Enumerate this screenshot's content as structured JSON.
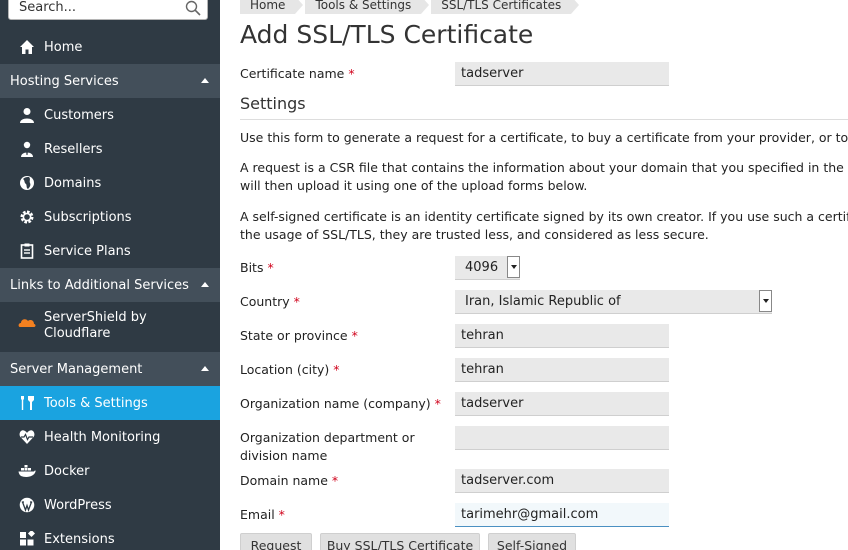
{
  "search": {
    "placeholder": "Search..."
  },
  "sidebar": {
    "home": "Home",
    "hosting_services": {
      "title": "Hosting Services",
      "items": [
        "Customers",
        "Resellers",
        "Domains",
        "Subscriptions",
        "Service Plans"
      ]
    },
    "additional_services": {
      "title": "Links to Additional Services",
      "items": [
        {
          "line1": "ServerShield by",
          "line2": "Cloudflare"
        }
      ]
    },
    "server_management": {
      "title": "Server Management",
      "items": [
        "Tools & Settings",
        "Health Monitoring",
        "Docker",
        "WordPress",
        "Extensions"
      ]
    }
  },
  "breadcrumb": [
    "Home",
    "Tools & Settings",
    "SSL/TLS Certificates"
  ],
  "page": {
    "title": "Add SSL/TLS Certificate",
    "settings_heading": "Settings",
    "para1": "Use this form to generate a request for a certificate, to buy a certificate from your provider, or to gen",
    "para2_line1": "A request is a CSR file that contains the information about your domain that you specified in the form",
    "para2_line2": "will then upload it using one of the upload forms below.",
    "para3_line1": "A self-signed certificate is an identity certificate signed by its own creator. If you use such a certificate",
    "para3_line2": "the usage of SSL/TLS, they are trusted less, and considered as less secure."
  },
  "form": {
    "certificate_name": {
      "label": "Certificate name",
      "value": "tadserver"
    },
    "bits": {
      "label": "Bits",
      "value": "4096"
    },
    "country": {
      "label": "Country",
      "value": "Iran, Islamic Republic of"
    },
    "state": {
      "label": "State or province",
      "value": "tehran"
    },
    "city": {
      "label": "Location (city)",
      "value": "tehran"
    },
    "organization": {
      "label": "Organization name (company)",
      "value": "tadserver"
    },
    "department": {
      "label_line1": "Organization department or",
      "label_line2": "division name",
      "value": ""
    },
    "domain": {
      "label": "Domain name",
      "value": "tadserver.com"
    },
    "email": {
      "label": "Email",
      "value": "tarimehr@gmail.com"
    },
    "required_mark": "*"
  },
  "buttons": {
    "request": "Request",
    "buy": "Buy SSL/TLS Certificate",
    "self_signed": "Self-Signed"
  },
  "colors": {
    "sidebar_bg": "#2f3a44",
    "section_bg": "#434f5a",
    "active": "#1aa3e0",
    "required": "#d0021b",
    "cloudflare": "#f38020"
  }
}
